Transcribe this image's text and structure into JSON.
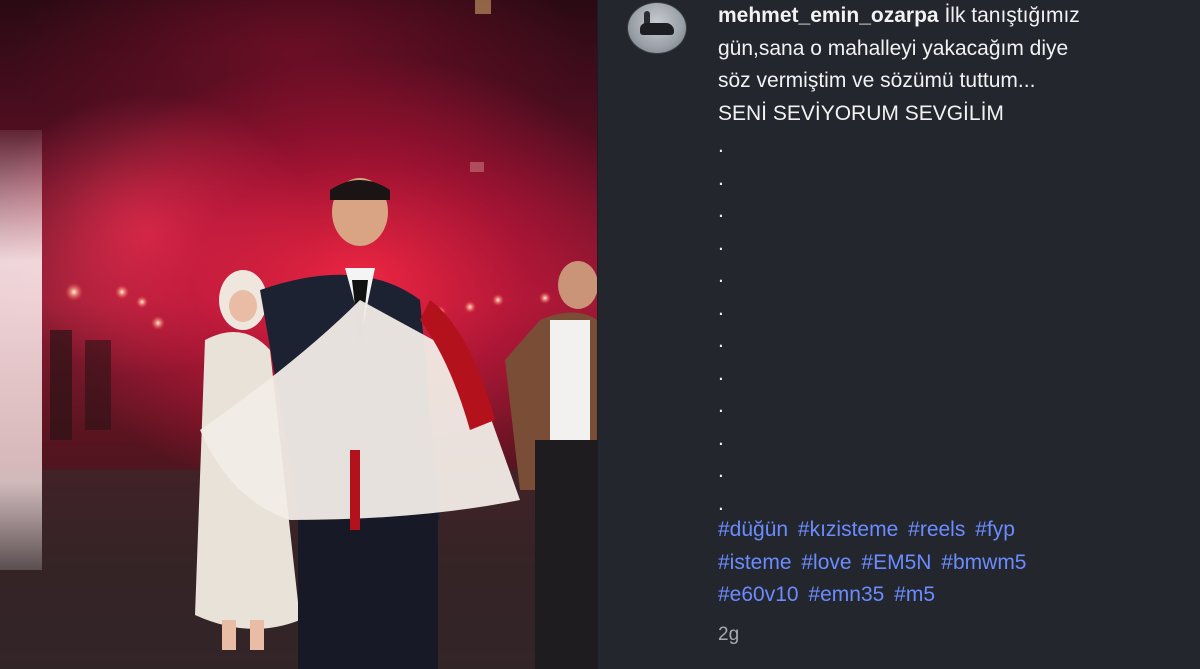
{
  "post": {
    "username": "mehmet_emin_ozarpa",
    "caption_lines": [
      "İlk tanıştığımız",
      "gün,sana o mahalleyi yakacağım diye",
      "söz vermiştim ve sözümü tuttum...",
      "SENİ SEVİYORUM SEVGİLİM"
    ],
    "dots": [
      ".",
      ".",
      ".",
      ".",
      ".",
      ".",
      ".",
      ".",
      ".",
      ".",
      ".",
      "."
    ],
    "hashtags": [
      [
        "#düğün",
        "#kızisteme",
        "#reels",
        "#fyp"
      ],
      [
        "#isteme",
        "#love",
        "#EM5N",
        "#bmwm5"
      ],
      [
        "#e60v10",
        "#emn35",
        "#m5"
      ]
    ],
    "time": "2g"
  },
  "photo": {
    "icon": "wedding-photo"
  },
  "colors": {
    "background": "#23262d",
    "hashtag": "#6b8cff",
    "text": "#f2f2f2",
    "timestamp": "#a7a9ad"
  }
}
